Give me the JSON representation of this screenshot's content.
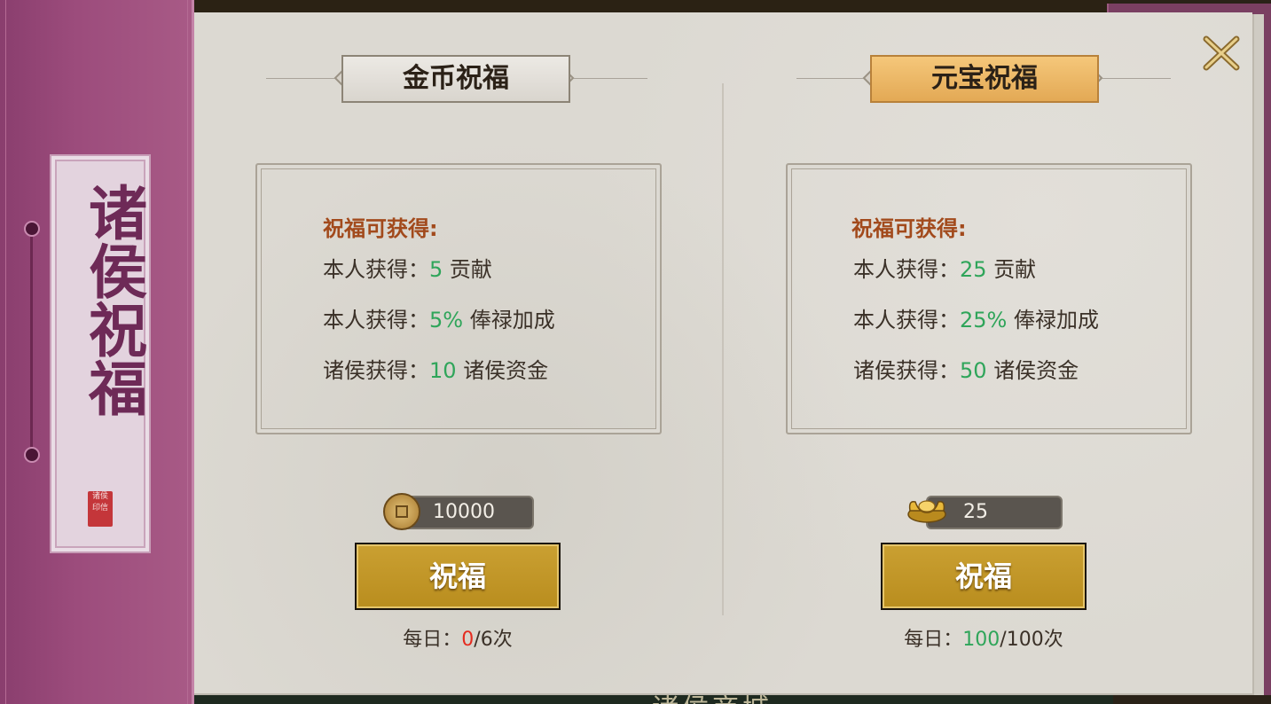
{
  "window": {
    "title": "诸侯祝福",
    "seal_text": "诸侯印信",
    "background_text": "诸侯商城"
  },
  "icons": {
    "close": "close-x-icon",
    "coin": "copper-coin-icon",
    "ingot": "gold-ingot-icon"
  },
  "colors": {
    "highlight_green": "#2fa55a",
    "warning_red": "#e52b1f",
    "header_orange": "#a24a1c",
    "button_gold": "#c49a2a"
  },
  "coin_blessing": {
    "header": "金币祝福",
    "reward_title": "祝福可获得:",
    "rewards": [
      {
        "label": "本人获得：",
        "value": "5",
        "unit": "贡献"
      },
      {
        "label": "本人获得：",
        "value": "5%",
        "unit": "俸禄加成"
      },
      {
        "label": "诸侯获得：",
        "value": "10",
        "unit": "诸侯资金"
      }
    ],
    "cost": "10000",
    "button": "祝福",
    "daily_label": "每日：",
    "daily_used": "0",
    "daily_total": "/6次"
  },
  "ingot_blessing": {
    "header": "元宝祝福",
    "reward_title": "祝福可获得:",
    "rewards": [
      {
        "label": "本人获得：",
        "value": "25",
        "unit": "贡献"
      },
      {
        "label": "本人获得：",
        "value": "25%",
        "unit": "俸禄加成"
      },
      {
        "label": "诸侯获得：",
        "value": "50",
        "unit": "诸侯资金"
      }
    ],
    "cost": "25",
    "button": "祝福",
    "daily_label": "每日：",
    "daily_used": "100",
    "daily_total": "/100次"
  }
}
